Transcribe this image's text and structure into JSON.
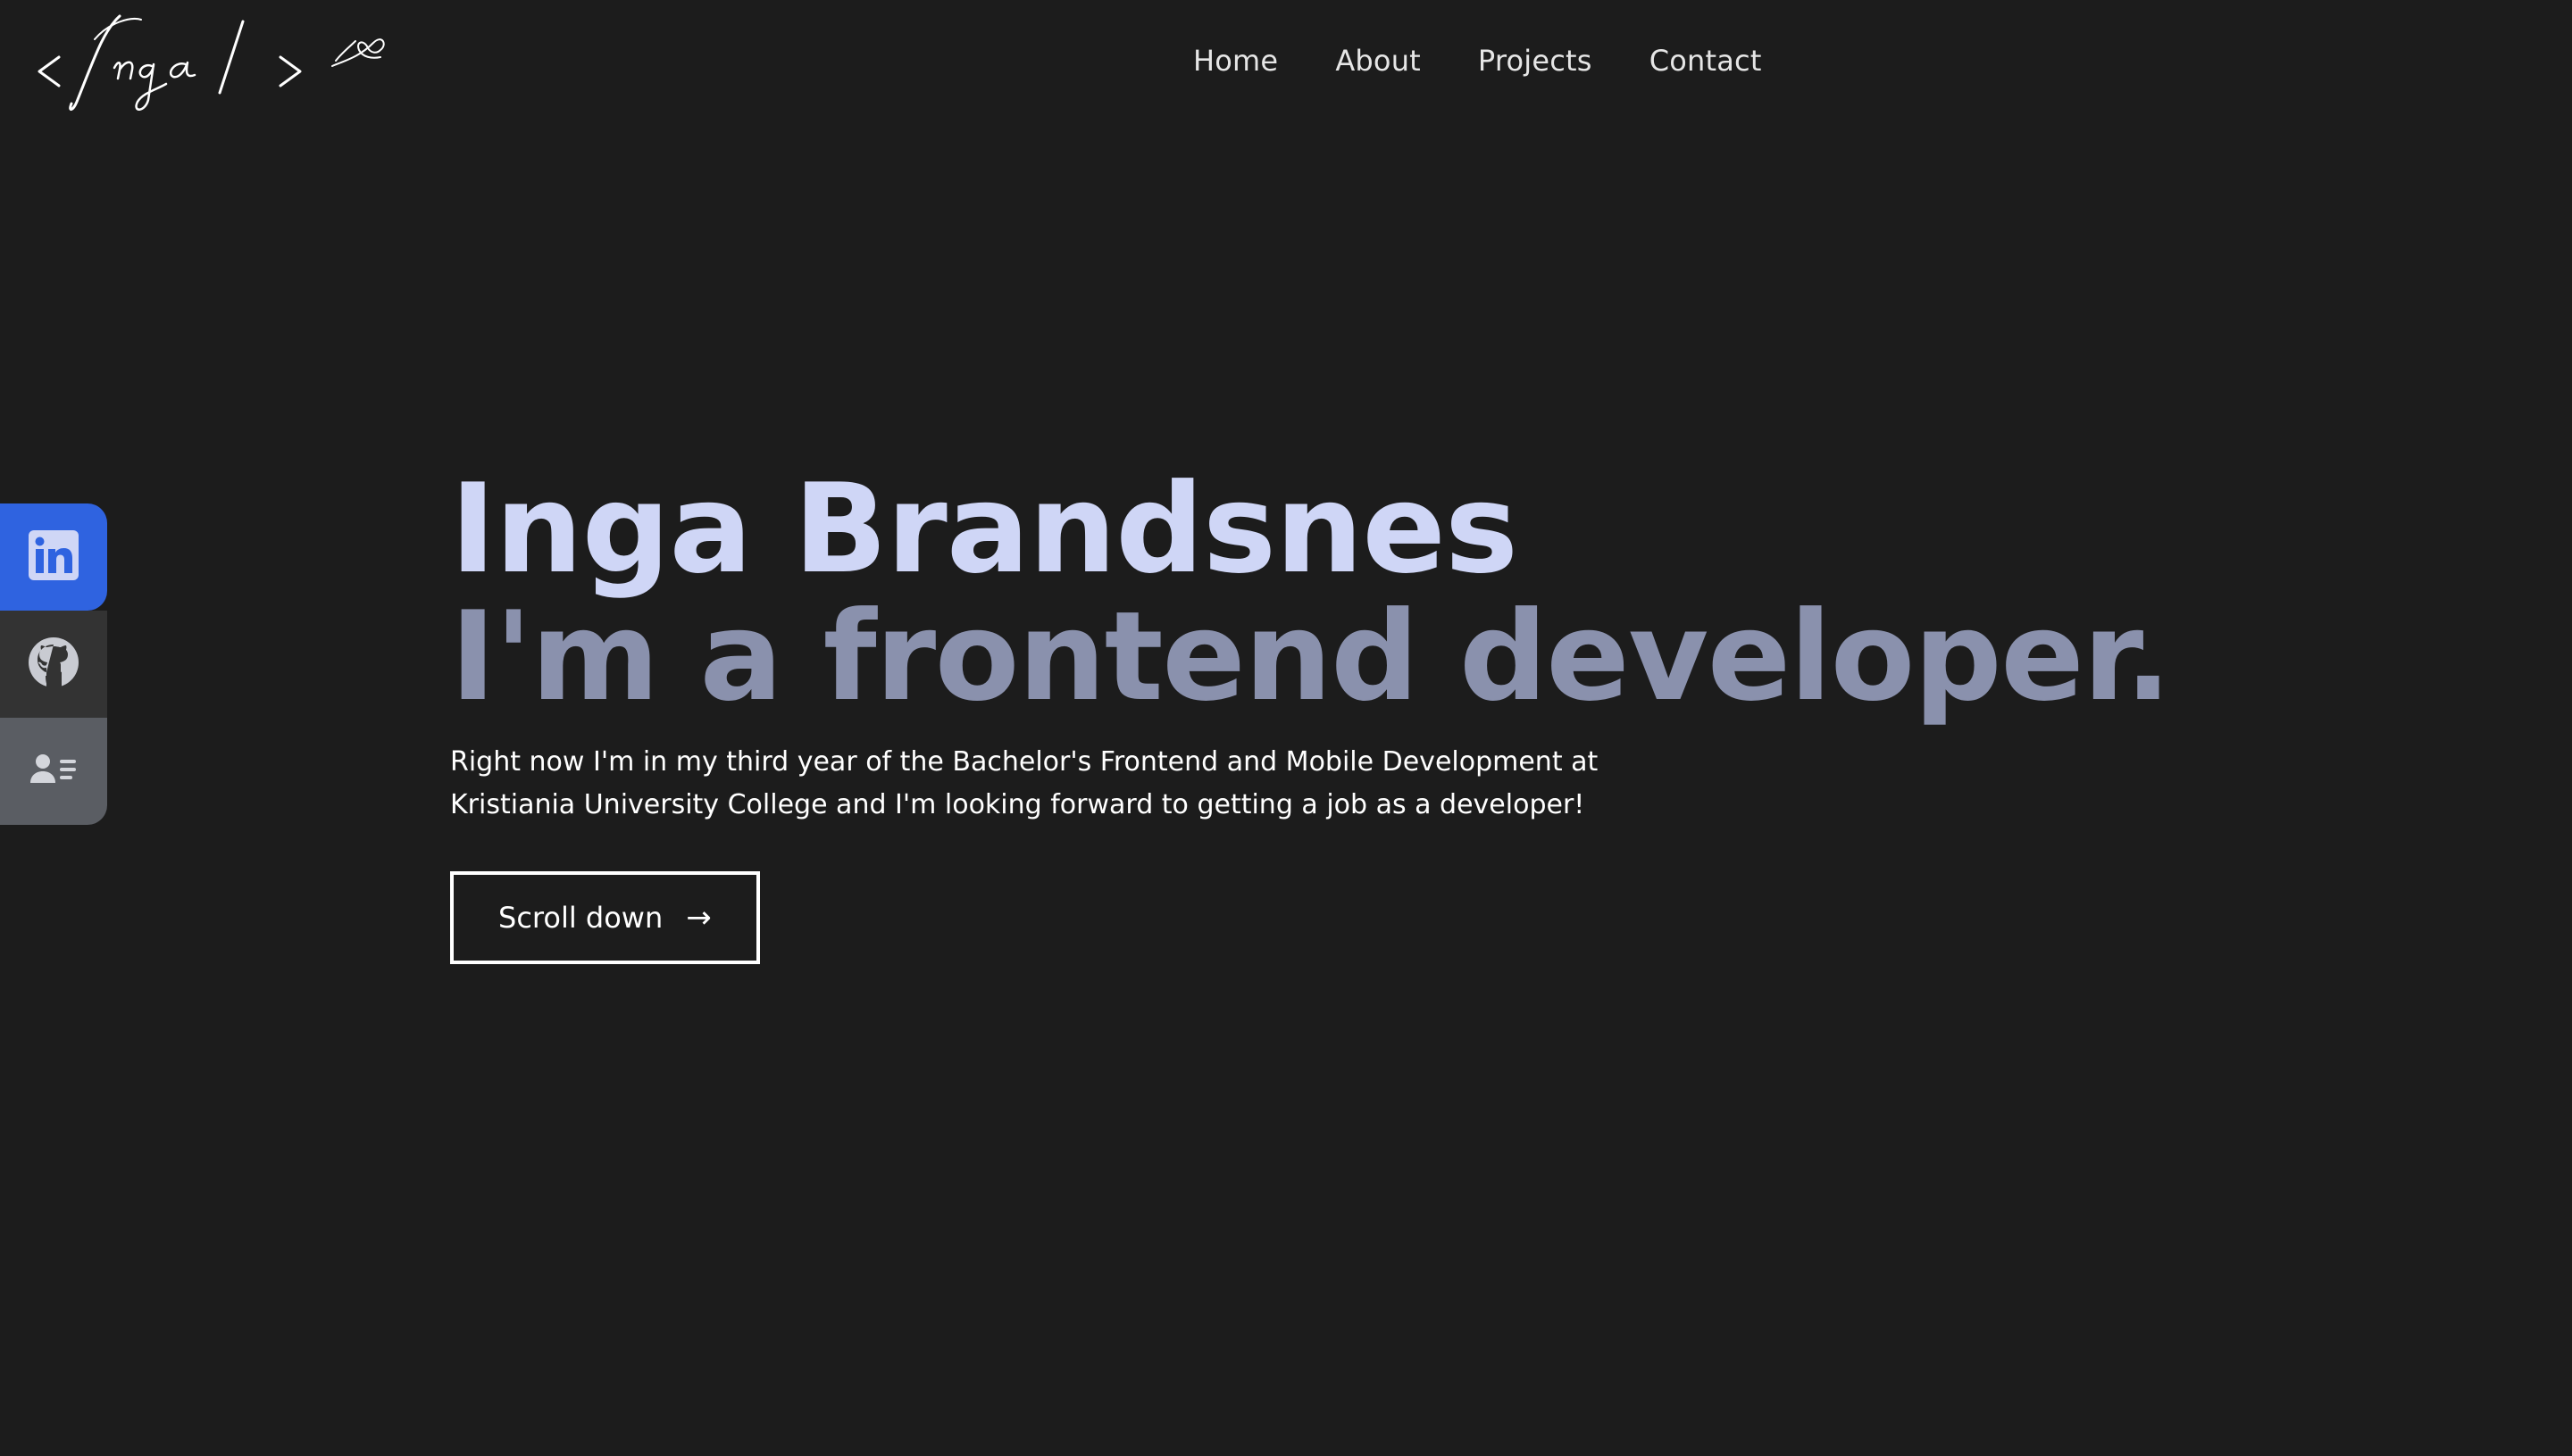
{
  "header": {
    "logo_text": "<Inga/>",
    "nav": [
      {
        "label": "Home"
      },
      {
        "label": "About"
      },
      {
        "label": "Projects"
      },
      {
        "label": "Contact"
      }
    ]
  },
  "social": [
    {
      "name": "linkedin",
      "icon": "linkedin-icon",
      "color": "#2f63e0"
    },
    {
      "name": "github",
      "icon": "github-icon",
      "color": "#333333"
    },
    {
      "name": "resume",
      "icon": "contact-card-icon",
      "color": "#5a5d63"
    }
  ],
  "hero": {
    "name": "Inga Brandsnes",
    "role": "I'm a frontend developer.",
    "text": "Right now I'm in my third year of the Bachelor's Frontend and Mobile Development at Kristiania University College and I'm looking forward to getting a job as a developer!",
    "button_label": "Scroll down",
    "button_arrow": "→"
  },
  "colors": {
    "background": "#1c1c1c",
    "name": "#cfd6f6",
    "role": "#8a91ad",
    "accent": "#2f63e0"
  }
}
